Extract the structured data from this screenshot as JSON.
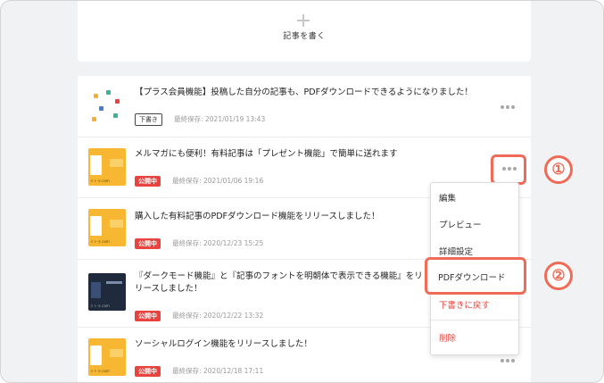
{
  "write_card": {
    "label": "記事を書く"
  },
  "articles": [
    {
      "title": "【プラス会員機能】投稿した自分の記事も、PDFダウンロードできるようになりました！",
      "status": "下書き",
      "saved": "最終保存: 2021/01/19 13:43"
    },
    {
      "title": "メルマガにも便利！有料記事は「プレゼント機能」で簡単に送れます",
      "status": "公開中",
      "saved": "最終保存: 2021/01/06 19:16"
    },
    {
      "title": "購入した有料記事のPDFダウンロード機能をリリースしました！",
      "status": "公開中",
      "saved": "最終保存: 2020/12/23 15:25"
    },
    {
      "title": "『ダークモード機能』と『記事のフォントを明朝体で表示できる機能』をリリースしました！",
      "status": "公開中",
      "saved": "最終保存: 2020/12/22 13:32"
    },
    {
      "title": "ソーシャルログイン機能をリリースしました！",
      "status": "公開中",
      "saved": "最終保存: 2020/12/18 17:11"
    }
  ],
  "thumb_brand": "ミトラ.com",
  "menu": {
    "edit": "編集",
    "preview": "プレビュー",
    "settings": "詳細設定",
    "pdf_download": "PDFダウンロード",
    "revert_draft": "下書きに戻す",
    "delete": "削除"
  },
  "steps": [
    "①",
    "②"
  ],
  "colors": {
    "accent": "#ef6b57",
    "published": "#e8433e",
    "thumb_yellow": "#f7b733"
  },
  "icons": {
    "more": "more-horizontal-icon",
    "add": "plus-icon"
  }
}
